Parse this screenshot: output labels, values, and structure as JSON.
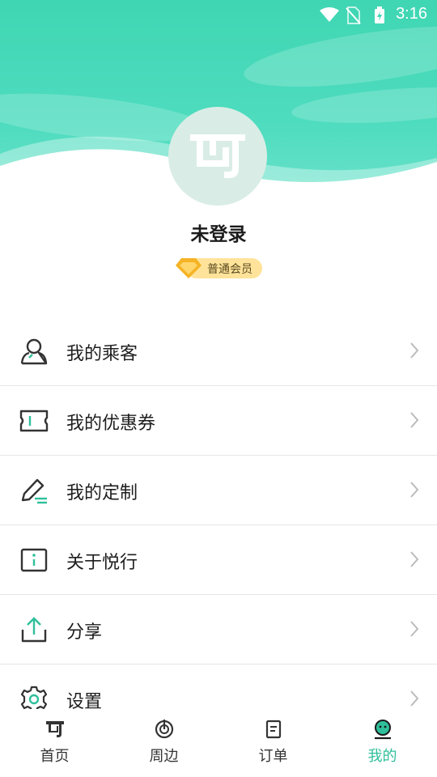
{
  "status_bar": {
    "time": "3:16"
  },
  "profile": {
    "username": "未登录",
    "member_badge": "普通会员"
  },
  "menu": {
    "items": [
      {
        "label": "我的乘客",
        "icon": "passenger-icon"
      },
      {
        "label": "我的优惠券",
        "icon": "coupon-icon"
      },
      {
        "label": "我的定制",
        "icon": "edit-pen-icon"
      },
      {
        "label": "关于悦行",
        "icon": "info-icon"
      },
      {
        "label": "分享",
        "icon": "share-icon"
      },
      {
        "label": "设置",
        "icon": "gear-icon"
      }
    ]
  },
  "tabbar": {
    "tabs": [
      {
        "label": "首页",
        "icon": "home-logo-icon"
      },
      {
        "label": "周边",
        "icon": "nearby-icon"
      },
      {
        "label": "订单",
        "icon": "order-icon"
      },
      {
        "label": "我的",
        "icon": "profile-icon"
      }
    ],
    "active": "我的"
  },
  "colors": {
    "accent": "#2fbf9b",
    "header": "#45d8b8",
    "badge": "#ffe39a"
  }
}
